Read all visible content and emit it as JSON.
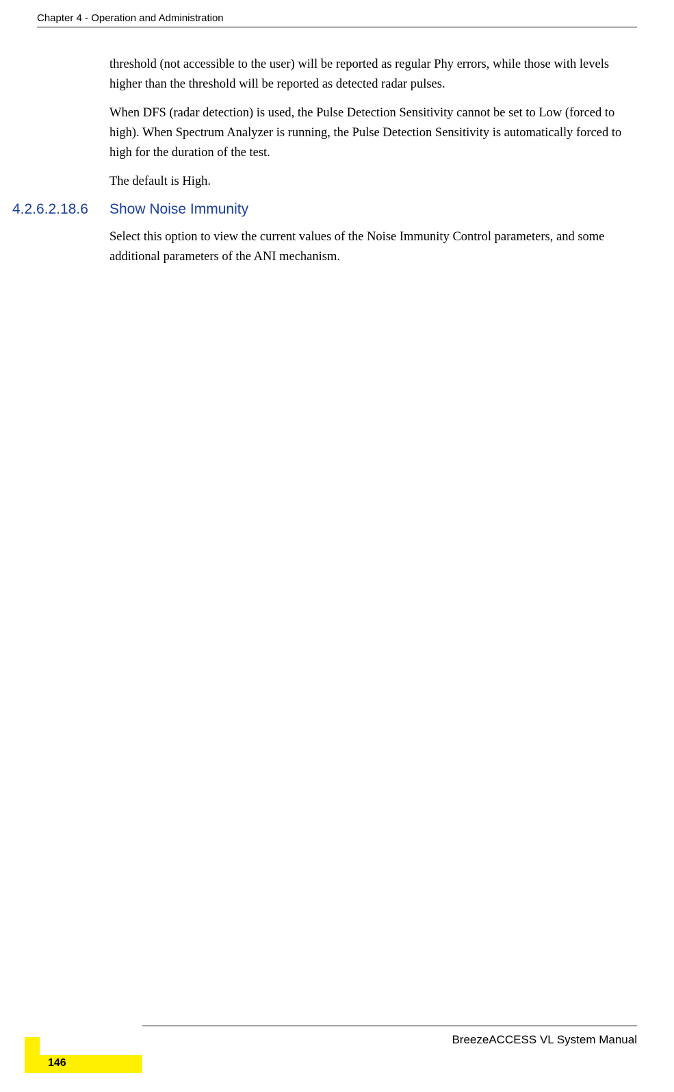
{
  "header": "Chapter 4 - Operation and Administration",
  "paragraphs": {
    "p1": "threshold (not accessible to the user) will be reported as regular Phy errors, while those with levels higher than the threshold will be reported as detected radar pulses.",
    "p2": "When DFS (radar detection) is used, the Pulse Detection Sensitivity cannot be set to Low (forced to high). When Spectrum Analyzer is running, the Pulse Detection Sensitivity is automatically forced to high for the duration of the test.",
    "p3": "The default is High.",
    "p4": "Select this option to view the current values of the Noise Immunity Control parameters, and some additional parameters of the ANI mechanism."
  },
  "section": {
    "number": "4.2.6.2.18.6",
    "title": "Show Noise Immunity"
  },
  "footer": {
    "manual": "BreezeACCESS VL System Manual",
    "page": "146"
  }
}
